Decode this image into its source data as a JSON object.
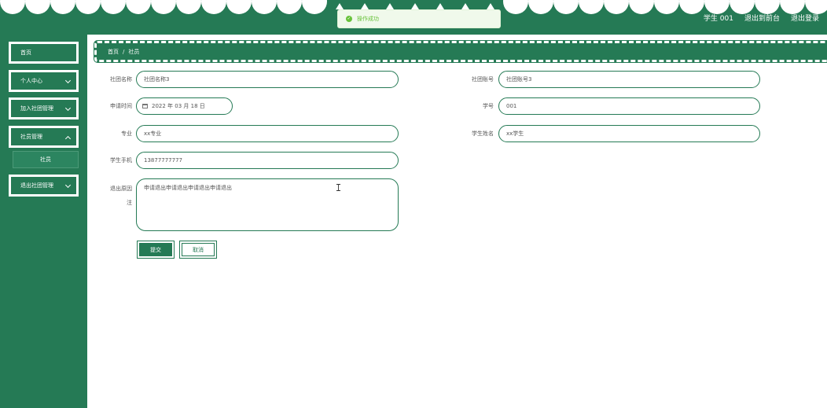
{
  "header": {
    "user_name": "学生 001",
    "to_front_label": "退出到前台",
    "logout_label": "退出登录"
  },
  "toast": {
    "message": "操作成功"
  },
  "sidebar": {
    "items": [
      {
        "label": "首页"
      },
      {
        "label": "个人中心"
      },
      {
        "label": "加入社团管理"
      },
      {
        "label": "社员管理"
      },
      {
        "label": "退出社团管理"
      }
    ],
    "sub_items": [
      {
        "label": "社员"
      }
    ]
  },
  "breadcrumb": {
    "home": "首页",
    "separator": "/",
    "current": "社员"
  },
  "form": {
    "club_name_label": "社团名称",
    "club_name_value": "社团名称3",
    "club_account_label": "社团账号",
    "club_account_value": "社团账号3",
    "apply_time_label": "申请时间",
    "apply_time_value": "2022 年 03 月 18 日",
    "student_id_label": "学号",
    "student_id_value": "001",
    "major_label": "专业",
    "major_value": "xx专业",
    "student_name_label": "学生姓名",
    "student_name_value": "xx学生",
    "phone_label": "学生手机",
    "phone_value": "13877777777",
    "reason_label_line1": "退出原因",
    "reason_label_line2": "注",
    "reason_value": "申请退出申请退出申请退出申请退出",
    "submit_label": "提交",
    "cancel_label": "取消"
  },
  "colors": {
    "primary": "#257a55",
    "toast_bg": "#f0f9eb",
    "toast_text": "#67c23a"
  }
}
